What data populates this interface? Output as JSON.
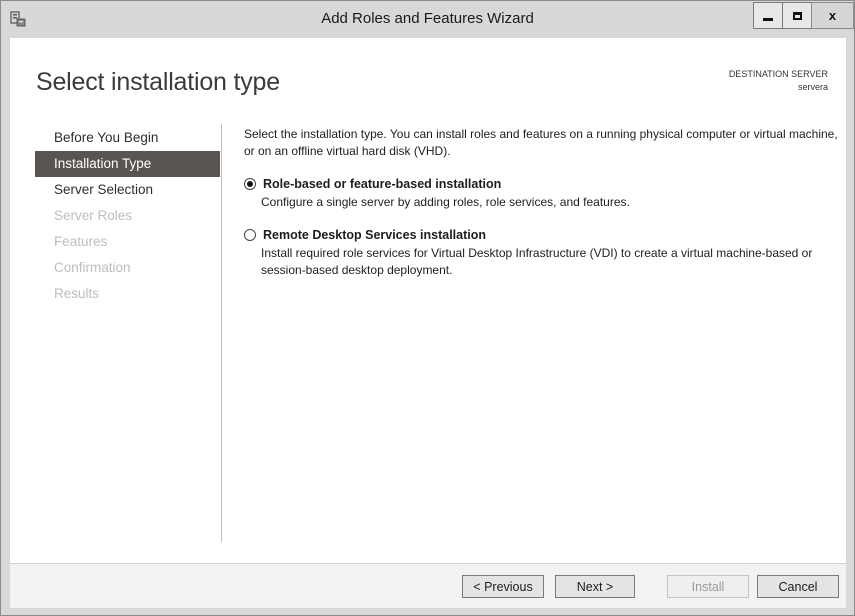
{
  "window": {
    "title": "Add Roles and Features Wizard",
    "icon": "server-manager-icon",
    "controls": {
      "minimize_icon": "minimize-icon",
      "maximize_icon": "maximize-icon",
      "close_label": "x"
    }
  },
  "header": {
    "page_title": "Select installation type",
    "destination_label": "DESTINATION SERVER",
    "destination_value": "servera"
  },
  "nav": {
    "items": [
      {
        "label": "Before You Begin",
        "state": "enabled"
      },
      {
        "label": "Installation Type",
        "state": "active"
      },
      {
        "label": "Server Selection",
        "state": "enabled"
      },
      {
        "label": "Server Roles",
        "state": "disabled"
      },
      {
        "label": "Features",
        "state": "disabled"
      },
      {
        "label": "Confirmation",
        "state": "disabled"
      },
      {
        "label": "Results",
        "state": "disabled"
      }
    ]
  },
  "main": {
    "intro": "Select the installation type. You can install roles and features on a running physical computer or virtual machine, or on an offline virtual hard disk (VHD).",
    "options": [
      {
        "label": "Role-based or feature-based installation",
        "description": "Configure a single server by adding roles, role services, and features.",
        "selected": true
      },
      {
        "label": "Remote Desktop Services installation",
        "description": "Install required role services for Virtual Desktop Infrastructure (VDI) to create a virtual machine-based or session-based desktop deployment.",
        "selected": false
      }
    ]
  },
  "footer": {
    "previous_label": "< Previous",
    "next_label": "Next >",
    "install_label": "Install",
    "cancel_label": "Cancel"
  },
  "colors": {
    "nav_active_bg": "#5a5450",
    "disabled_text": "#bdbdbd",
    "title_bar": "#d8d8d8"
  }
}
